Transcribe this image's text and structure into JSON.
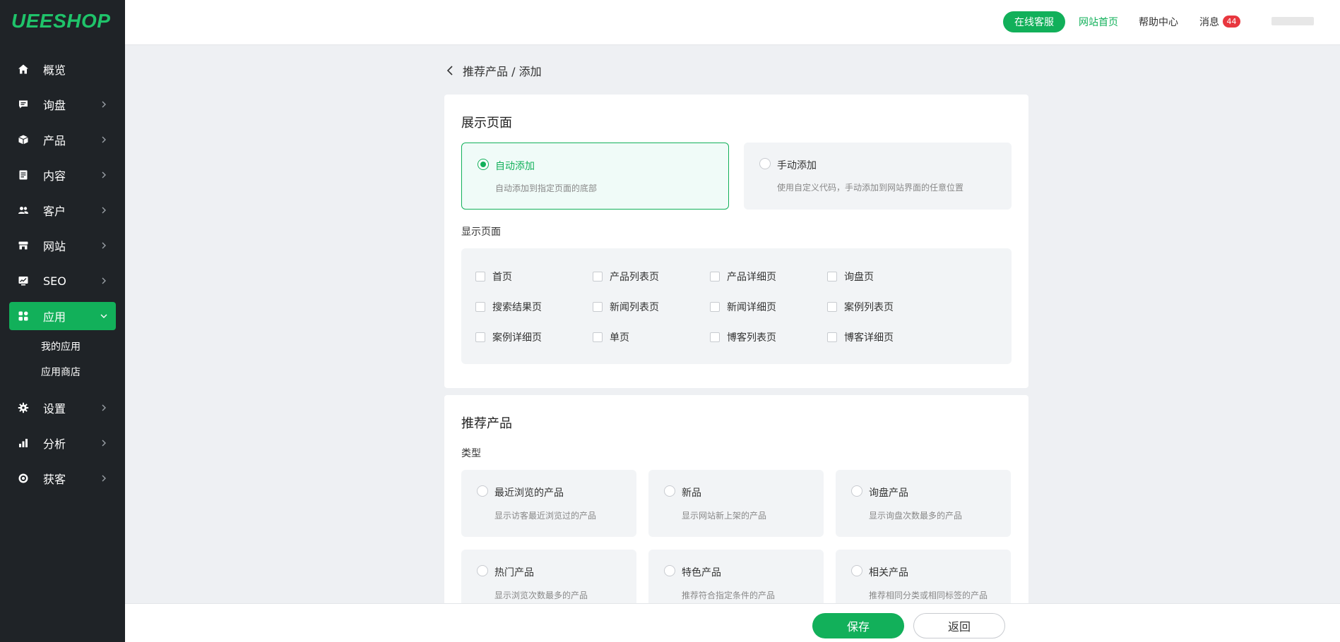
{
  "brand": {
    "logo": "UEESHOP",
    "accent": "#12b05a"
  },
  "sidebar": {
    "items": [
      {
        "label": "概览",
        "icon": "home-icon"
      },
      {
        "label": "询盘",
        "icon": "message-icon"
      },
      {
        "label": "产品",
        "icon": "box-icon"
      },
      {
        "label": "内容",
        "icon": "document-icon"
      },
      {
        "label": "客户",
        "icon": "users-icon"
      },
      {
        "label": "网站",
        "icon": "store-icon"
      },
      {
        "label": "SEO",
        "icon": "chart-monitor-icon"
      },
      {
        "label": "应用",
        "icon": "apps-grid-icon",
        "active": true
      },
      {
        "label": "设置",
        "icon": "gear-icon"
      },
      {
        "label": "分析",
        "icon": "bar-chart-icon"
      },
      {
        "label": "获客",
        "icon": "target-icon"
      }
    ],
    "app_submenu": [
      "我的应用",
      "应用商店"
    ]
  },
  "topbar": {
    "service_button": "在线客服",
    "home_link": "网站首页",
    "help_link": "帮助中心",
    "messages_link": "消息",
    "messages_count": "44"
  },
  "breadcrumb": {
    "text": "推荐产品 / 添加"
  },
  "display_section": {
    "title": "展示页面",
    "options": [
      {
        "title": "自动添加",
        "desc": "自动添加到指定页面的底部",
        "selected": true
      },
      {
        "title": "手动添加",
        "desc": "使用自定义代码，手动添加到网站界面的任意位置",
        "selected": false
      }
    ],
    "pages_label": "显示页面",
    "pages": [
      [
        "首页",
        "产品列表页",
        "产品详细页",
        "询盘页"
      ],
      [
        "搜索结果页",
        "新闻列表页",
        "新闻详细页",
        "案例列表页"
      ],
      [
        "案例详细页",
        "单页",
        "博客列表页",
        "博客详细页"
      ]
    ]
  },
  "recommend_section": {
    "title": "推荐产品",
    "type_label": "类型",
    "types": [
      {
        "title": "最近浏览的产品",
        "desc": "显示访客最近浏览过的产品"
      },
      {
        "title": "新品",
        "desc": "显示网站新上架的产品"
      },
      {
        "title": "询盘产品",
        "desc": "显示询盘次数最多的产品"
      },
      {
        "title": "热门产品",
        "desc": "显示浏览次数最多的产品"
      },
      {
        "title": "特色产品",
        "desc": "推荐符合指定条件的产品"
      },
      {
        "title": "相关产品",
        "desc": "推荐相同分类或相同标签的产品"
      }
    ]
  },
  "footer": {
    "save_label": "保存",
    "back_label": "返回"
  }
}
